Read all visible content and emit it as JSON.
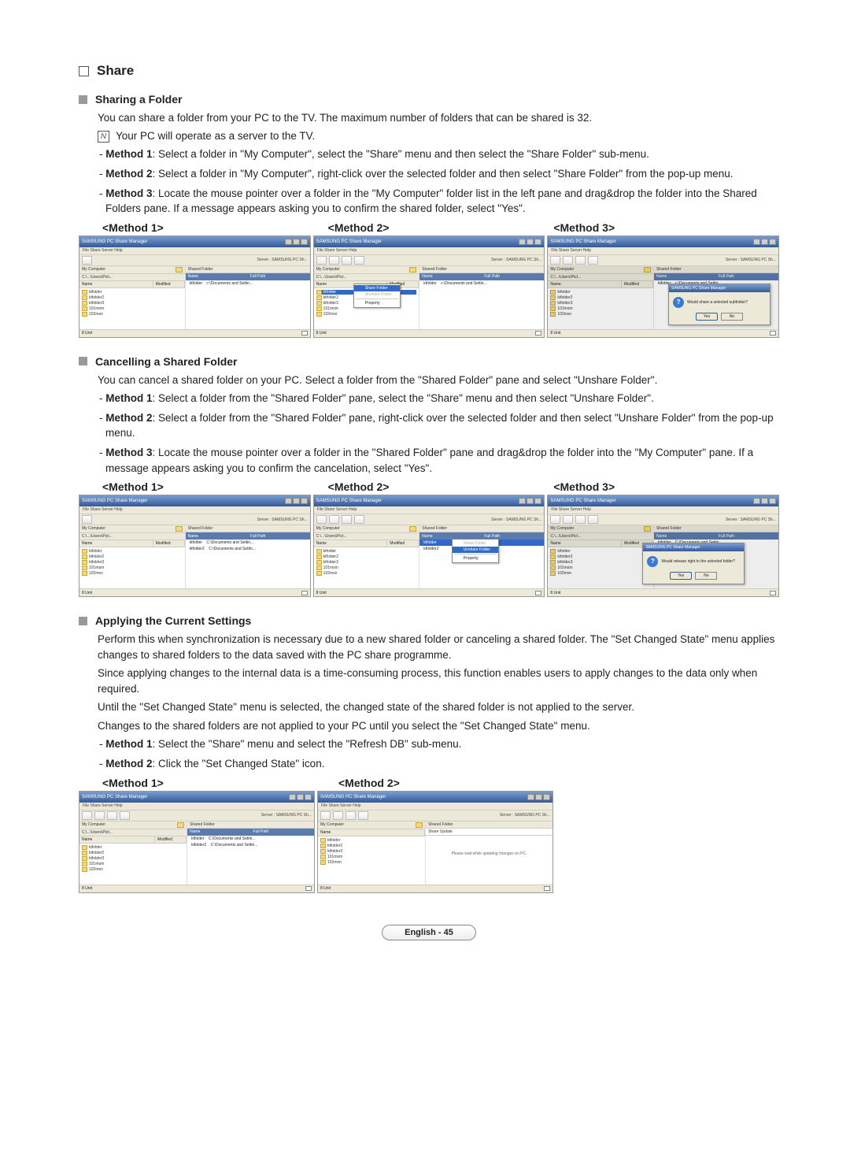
{
  "section": {
    "title": "Share"
  },
  "share": {
    "heading": "Sharing a Folder",
    "intro": "You can share a folder from your PC to the TV.  The maximum number of folders that can be shared is 32.",
    "note": "Your PC will operate as a server to the TV.",
    "m1": "- Method 1: Select a folder in \"My Computer\", select the \"Share\" menu and then select the \"Share Folder\" sub-menu.",
    "m1_lead": "Method 1",
    "m2": "- Method 2: Select a folder in \"My Computer\", right-click over the selected folder and then select \"Share Folder\" from the pop-up menu.",
    "m2_lead": "Method 2",
    "m3a": "- Method 3: Locate the mouse pointer over a folder in the \"My Computer\" folder list in the left pane and drag&drop the folder into the Shared Folders pane. If a message appears asking you to confirm the shared folder, select \"Yes\".",
    "m3_lead": "Method 3"
  },
  "cancel": {
    "heading": "Cancelling a Shared Folder",
    "intro": "You can cancel a shared folder on your PC. Select a folder from the \"Shared Folder\" pane and select \"Unshare Folder\".",
    "m1": "- Method 1: Select a folder from the \"Shared Folder\" pane, select the \"Share\" menu and then select \"Unshare Folder\".",
    "m2": "- Method 2: Select a folder from the \"Shared Folder\" pane, right-click over the selected folder and then select \"Unshare Folder\" from the pop-up menu.",
    "m3": "- Method 3: Locate the mouse pointer over a folder in the \"Shared Folder\" pane and drag&drop the folder into the \"My Computer\" pane. If a message appears asking you to confirm the cancelation, select \"Yes\"."
  },
  "apply": {
    "heading": "Applying the Current Settings",
    "p1": "Perform this when synchronization is necessary due to a new shared folder or canceling a shared folder. The \"Set Changed State\" menu applies changes to shared folders to the data saved with the PC share programme.",
    "p2": "Since applying changes to the internal data is a time-consuming process, this function enables users to apply changes to the data only when required.",
    "p3": "Until the \"Set Changed State\" menu is selected, the changed state of the shared folder is not applied to the server.",
    "p4": "Changes to the shared folders are not applied to your PC until you select the \"Set Changed State\" menu.",
    "m1": "- Method 1: Select the \"Share\" menu and select the \"Refresh DB\" sub-menu.",
    "m2": "- Method 2: Click the \"Set Changed State\" icon."
  },
  "method_labels": {
    "m1": "<Method 1>",
    "m2": "<Method 2>",
    "m3": "<Method 3>"
  },
  "screenshot": {
    "winTitle": "SAMSUNG PC Share Manager",
    "menubar": "File    Share    Server    Help",
    "serverLabel": "Server : SAMSUNG PC Sh...",
    "leftPane": "My Computer",
    "rightPane": "Shared Folder",
    "navPath": "C:\\...\\Users\\Pict...",
    "colName": "Name",
    "colModified": "Modified",
    "colFullPath": "Full Path",
    "folders": [
      "ktfolder",
      "ktfolder2",
      "ktfolder3",
      "101msm",
      "102msn"
    ],
    "sharedItem": "ktfolder",
    "sharedPath": "c:\\Documents and Settin...",
    "pathDocs": "C:\\Documents and Settin...",
    "statusUnit": "8 Unit"
  },
  "ctx": {
    "share": {
      "shareFolder": "Share Folder",
      "unshare": "Unshare Folder",
      "property": "Property"
    },
    "cancel": {
      "shareFolder": "Share Folder",
      "unshareFolder": "Unshare Folder",
      "property": "Property"
    }
  },
  "dlg": {
    "title": "SAMSUNG PC Share Manager",
    "shareMsg": "Would share a selected subfolder?",
    "cancelMsg": "Would release right to the selected folder?",
    "yes": "Yes",
    "no": "No"
  },
  "update": {
    "heading": "Share Update",
    "msg": "Please wait while updating changes on PC."
  },
  "footer": {
    "page": "English - 45"
  }
}
